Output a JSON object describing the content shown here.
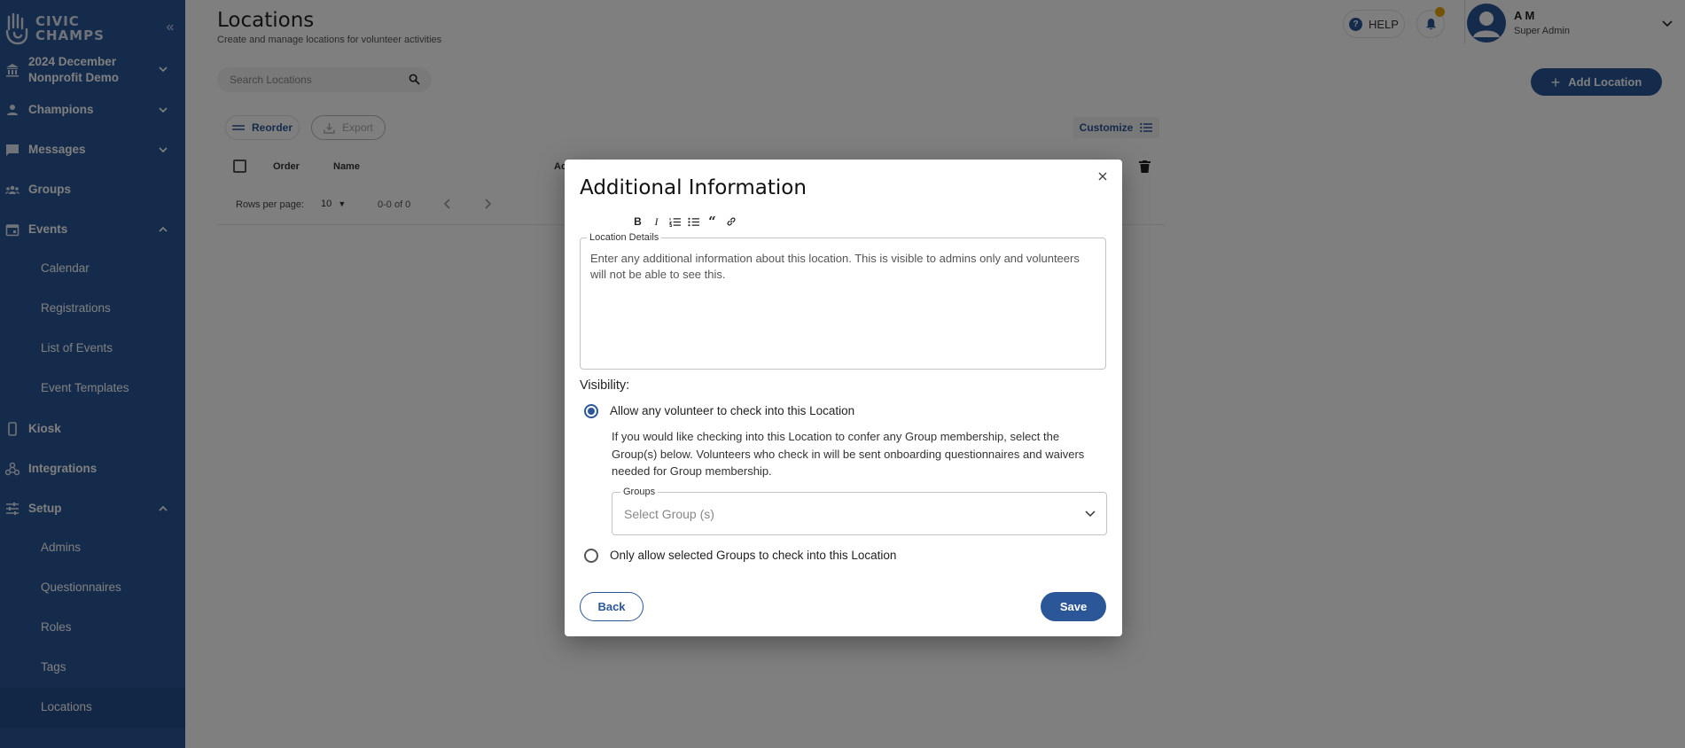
{
  "sidebar": {
    "logo_line1": "CIVIC",
    "logo_line2": "CHAMPS",
    "org_line1": "2024 December",
    "org_line2": "Nonprofit Demo",
    "items": {
      "champions": "Champions",
      "messages": "Messages",
      "groups": "Groups",
      "events": "Events",
      "calendar": "Calendar",
      "registrations": "Registrations",
      "list_of_events": "List of Events",
      "event_templates": "Event Templates",
      "kiosk": "Kiosk",
      "integrations": "Integrations",
      "setup": "Setup",
      "admins": "Admins",
      "questionnaires": "Questionnaires",
      "roles": "Roles",
      "tags": "Tags",
      "locations": "Locations"
    }
  },
  "header": {
    "title": "Locations",
    "subtitle": "Create and manage locations for volunteer activities",
    "help_label": "HELP",
    "user_name": "A M",
    "user_role": "Super Admin"
  },
  "toolbar": {
    "search_placeholder": "Search Locations",
    "add_label": "Add Location",
    "reorder_label": "Reorder",
    "export_label": "Export",
    "customize_label": "Customize"
  },
  "table": {
    "columns": [
      "Order",
      "Name",
      "Ac"
    ],
    "rows_per_page_label": "Rows per page:",
    "rows_per_page_value": "10",
    "range": "0-0 of 0"
  },
  "modal": {
    "title": "Additional Information",
    "details_legend": "Location Details",
    "details_placeholder": "Enter any additional information about this location. This is visible to admins only and volunteers will not be able to see this.",
    "visibility_label": "Visibility:",
    "option_any": "Allow any volunteer to check into this Location",
    "option_any_help": "If you would like checking into this Location to confer any Group membership, select the Group(s) below. Volunteers who check in will be sent onboarding questionnaires and waivers needed for Group membership.",
    "groups_legend": "Groups",
    "groups_placeholder": "Select Group (s)",
    "option_selected": "Only allow selected Groups to check into this Location",
    "back_label": "Back",
    "save_label": "Save"
  },
  "colors": {
    "brand": "#2b5799",
    "notification_dot": "#e9a500"
  }
}
